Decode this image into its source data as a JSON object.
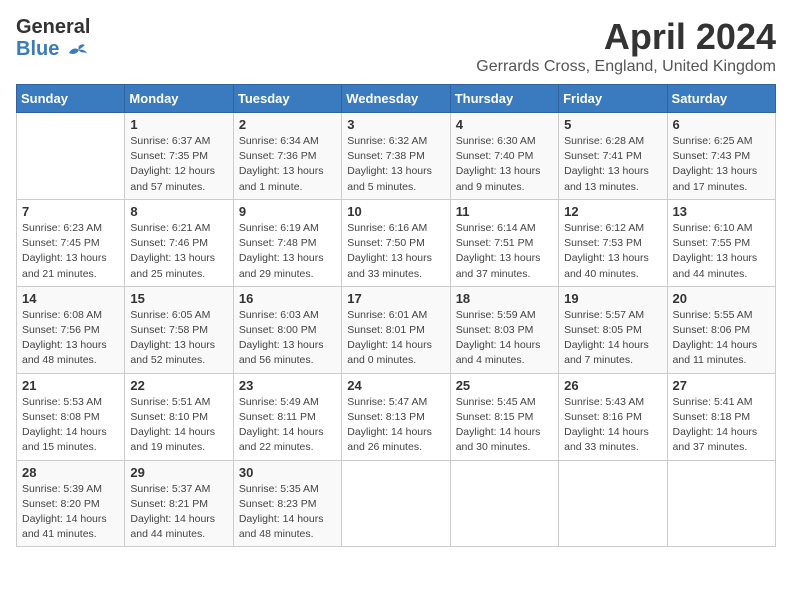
{
  "header": {
    "logo_general": "General",
    "logo_blue": "Blue",
    "month": "April 2024",
    "location": "Gerrards Cross, England, United Kingdom"
  },
  "calendar": {
    "weekdays": [
      "Sunday",
      "Monday",
      "Tuesday",
      "Wednesday",
      "Thursday",
      "Friday",
      "Saturday"
    ],
    "weeks": [
      [
        {
          "day": "",
          "info": ""
        },
        {
          "day": "1",
          "info": "Sunrise: 6:37 AM\nSunset: 7:35 PM\nDaylight: 12 hours\nand 57 minutes."
        },
        {
          "day": "2",
          "info": "Sunrise: 6:34 AM\nSunset: 7:36 PM\nDaylight: 13 hours\nand 1 minute."
        },
        {
          "day": "3",
          "info": "Sunrise: 6:32 AM\nSunset: 7:38 PM\nDaylight: 13 hours\nand 5 minutes."
        },
        {
          "day": "4",
          "info": "Sunrise: 6:30 AM\nSunset: 7:40 PM\nDaylight: 13 hours\nand 9 minutes."
        },
        {
          "day": "5",
          "info": "Sunrise: 6:28 AM\nSunset: 7:41 PM\nDaylight: 13 hours\nand 13 minutes."
        },
        {
          "day": "6",
          "info": "Sunrise: 6:25 AM\nSunset: 7:43 PM\nDaylight: 13 hours\nand 17 minutes."
        }
      ],
      [
        {
          "day": "7",
          "info": "Sunrise: 6:23 AM\nSunset: 7:45 PM\nDaylight: 13 hours\nand 21 minutes."
        },
        {
          "day": "8",
          "info": "Sunrise: 6:21 AM\nSunset: 7:46 PM\nDaylight: 13 hours\nand 25 minutes."
        },
        {
          "day": "9",
          "info": "Sunrise: 6:19 AM\nSunset: 7:48 PM\nDaylight: 13 hours\nand 29 minutes."
        },
        {
          "day": "10",
          "info": "Sunrise: 6:16 AM\nSunset: 7:50 PM\nDaylight: 13 hours\nand 33 minutes."
        },
        {
          "day": "11",
          "info": "Sunrise: 6:14 AM\nSunset: 7:51 PM\nDaylight: 13 hours\nand 37 minutes."
        },
        {
          "day": "12",
          "info": "Sunrise: 6:12 AM\nSunset: 7:53 PM\nDaylight: 13 hours\nand 40 minutes."
        },
        {
          "day": "13",
          "info": "Sunrise: 6:10 AM\nSunset: 7:55 PM\nDaylight: 13 hours\nand 44 minutes."
        }
      ],
      [
        {
          "day": "14",
          "info": "Sunrise: 6:08 AM\nSunset: 7:56 PM\nDaylight: 13 hours\nand 48 minutes."
        },
        {
          "day": "15",
          "info": "Sunrise: 6:05 AM\nSunset: 7:58 PM\nDaylight: 13 hours\nand 52 minutes."
        },
        {
          "day": "16",
          "info": "Sunrise: 6:03 AM\nSunset: 8:00 PM\nDaylight: 13 hours\nand 56 minutes."
        },
        {
          "day": "17",
          "info": "Sunrise: 6:01 AM\nSunset: 8:01 PM\nDaylight: 14 hours\nand 0 minutes."
        },
        {
          "day": "18",
          "info": "Sunrise: 5:59 AM\nSunset: 8:03 PM\nDaylight: 14 hours\nand 4 minutes."
        },
        {
          "day": "19",
          "info": "Sunrise: 5:57 AM\nSunset: 8:05 PM\nDaylight: 14 hours\nand 7 minutes."
        },
        {
          "day": "20",
          "info": "Sunrise: 5:55 AM\nSunset: 8:06 PM\nDaylight: 14 hours\nand 11 minutes."
        }
      ],
      [
        {
          "day": "21",
          "info": "Sunrise: 5:53 AM\nSunset: 8:08 PM\nDaylight: 14 hours\nand 15 minutes."
        },
        {
          "day": "22",
          "info": "Sunrise: 5:51 AM\nSunset: 8:10 PM\nDaylight: 14 hours\nand 19 minutes."
        },
        {
          "day": "23",
          "info": "Sunrise: 5:49 AM\nSunset: 8:11 PM\nDaylight: 14 hours\nand 22 minutes."
        },
        {
          "day": "24",
          "info": "Sunrise: 5:47 AM\nSunset: 8:13 PM\nDaylight: 14 hours\nand 26 minutes."
        },
        {
          "day": "25",
          "info": "Sunrise: 5:45 AM\nSunset: 8:15 PM\nDaylight: 14 hours\nand 30 minutes."
        },
        {
          "day": "26",
          "info": "Sunrise: 5:43 AM\nSunset: 8:16 PM\nDaylight: 14 hours\nand 33 minutes."
        },
        {
          "day": "27",
          "info": "Sunrise: 5:41 AM\nSunset: 8:18 PM\nDaylight: 14 hours\nand 37 minutes."
        }
      ],
      [
        {
          "day": "28",
          "info": "Sunrise: 5:39 AM\nSunset: 8:20 PM\nDaylight: 14 hours\nand 41 minutes."
        },
        {
          "day": "29",
          "info": "Sunrise: 5:37 AM\nSunset: 8:21 PM\nDaylight: 14 hours\nand 44 minutes."
        },
        {
          "day": "30",
          "info": "Sunrise: 5:35 AM\nSunset: 8:23 PM\nDaylight: 14 hours\nand 48 minutes."
        },
        {
          "day": "",
          "info": ""
        },
        {
          "day": "",
          "info": ""
        },
        {
          "day": "",
          "info": ""
        },
        {
          "day": "",
          "info": ""
        }
      ]
    ]
  }
}
